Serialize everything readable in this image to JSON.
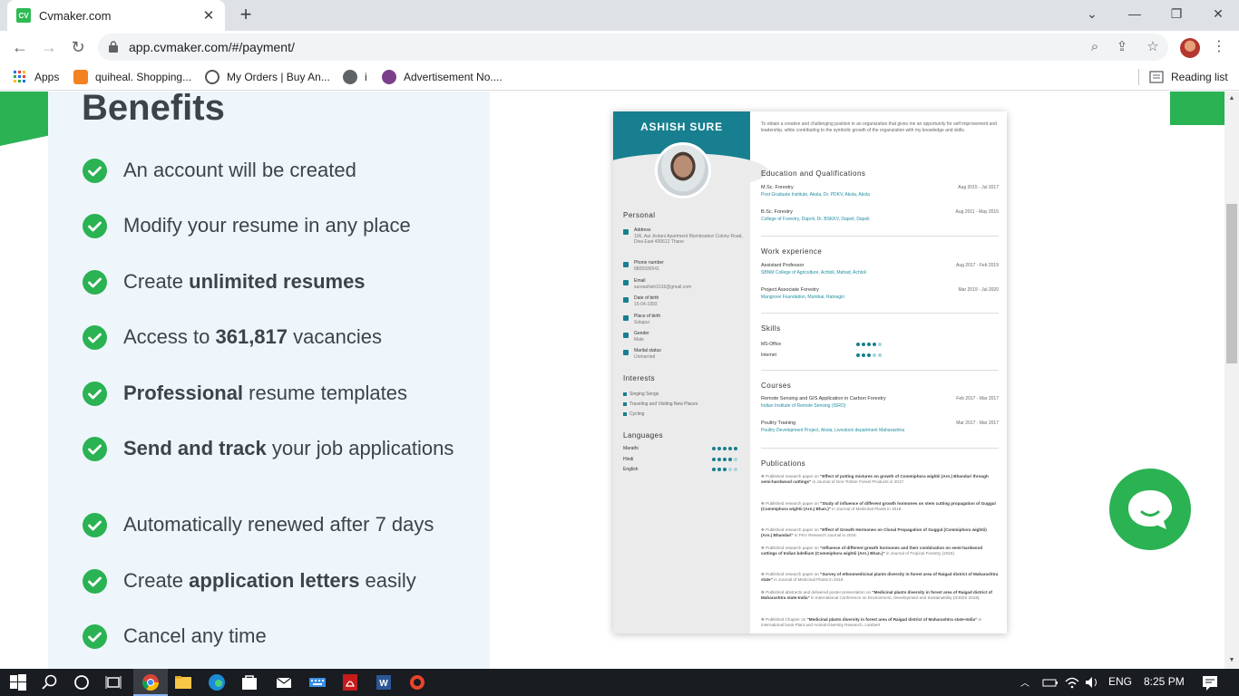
{
  "browser": {
    "tab_title": "Cvmaker.com",
    "favicon_text": "CV",
    "url": "app.cvmaker.com/#/payment/",
    "bookmarks": [
      {
        "label": "Apps",
        "icon": "apps-grid-icon"
      },
      {
        "label": "quiheal. Shopping...",
        "icon": "quiheal-icon"
      },
      {
        "label": "My Orders | Buy An...",
        "icon": "orders-icon"
      },
      {
        "label": "i",
        "icon": "globe-icon"
      },
      {
        "label": "Advertisement No....",
        "icon": "advert-icon"
      }
    ],
    "reading_list": "Reading list"
  },
  "benefits": {
    "title": "Benefits",
    "items": [
      {
        "pre": "An account will be created",
        "bold": "",
        "post": ""
      },
      {
        "pre": "Modify your resume in any place",
        "bold": "",
        "post": ""
      },
      {
        "pre": "Create ",
        "bold": "unlimited resumes",
        "post": ""
      },
      {
        "pre": "Access to ",
        "bold": "361,817",
        "post": " vacancies"
      },
      {
        "pre": "",
        "bold": "Professional",
        "post": " resume templates"
      },
      {
        "pre": "",
        "bold": "Send and track",
        "post": " your job applications"
      },
      {
        "pre": "Automatically renewed after 7 days",
        "bold": "",
        "post": ""
      },
      {
        "pre": "Create ",
        "bold": "application letters",
        "post": " easily"
      },
      {
        "pre": "Cancel any time",
        "bold": "",
        "post": ""
      }
    ]
  },
  "cv": {
    "name": "ASHISH SURE",
    "summary": "To obtain a creative and challenging position in an organization that gives me an opportunity for self improvement and leadership, while contributing to the symbolic growth of the organization with my knowledge and skills.",
    "personal_heading": "Personal",
    "personal": [
      {
        "label": "Address",
        "value": "106, Aai Jivdani Apartment Mumbradevi Colony Road, Diva East 400612 Thane"
      },
      {
        "label": "Phone number",
        "value": "8805930541"
      },
      {
        "label": "Email",
        "value": "sureashish1516@gmail.com"
      },
      {
        "label": "Date of birth",
        "value": "15-04-1993"
      },
      {
        "label": "Place of birth",
        "value": "Solapur"
      },
      {
        "label": "Gender",
        "value": "Male"
      },
      {
        "label": "Marital status",
        "value": "Unmarried"
      }
    ],
    "interests_heading": "Interests",
    "interests": [
      "Singing Songs",
      "Traveling and Visiting New Places",
      "Cycling"
    ],
    "languages_heading": "Languages",
    "languages": [
      {
        "name": "Marathi",
        "level": 5
      },
      {
        "name": "Hindi",
        "level": 4
      },
      {
        "name": "English",
        "level": 3
      }
    ],
    "education_heading": "Education and Qualifications",
    "education": [
      {
        "title": "M.Sc. Forestry",
        "sub": "Post Graduate Institute, Akola, Dr. PDKV, Akola, Akola",
        "date": "Aug 2015 - Jul 2017"
      },
      {
        "title": "B.Sc. Forestry",
        "sub": "College of Forestry, Dapoli, Dr. BSKKV, Dapoli, Dapoli",
        "date": "Aug 2011 - May 2015"
      }
    ],
    "work_heading": "Work experience",
    "work": [
      {
        "title": "Assistant Professor",
        "sub": "SBNM College of Agriculture, Achloli, Mahad, Achloli",
        "date": "Aug 2017 - Feb 2019"
      },
      {
        "title": "Project Associate Forestry",
        "sub": "Mangrove Foundation, Mumbai, Ratnagiri",
        "date": "Mar 2019 - Jul 2020"
      }
    ],
    "skills_heading": "Skills",
    "skills": [
      {
        "name": "MS-Office",
        "level": 4
      },
      {
        "name": "Internet",
        "level": 3
      }
    ],
    "courses_heading": "Courses",
    "courses": [
      {
        "title": "Remote Sensing and GIS Application in Carbon Forestry",
        "sub": "Indian Institute of Remote Sensing (ISRO)",
        "date": "Feb 2017 - Mar 2017"
      },
      {
        "title": "Poultry Training",
        "sub": "Poultry Development Project, Akola, Livestock department Maharashtra",
        "date": "Mar 2017 - Mar 2017"
      }
    ],
    "publications_heading": "Publications",
    "publications": [
      {
        "pre": "✥ Published research paper on ",
        "bold": "\"Effect of potting mixtures on growth of Commiphora wightii (Arn.) Bhandari through semi-hardwood cuttings\"",
        "post": " in Journal of Non-Timber Forest Products in 2017."
      },
      {
        "pre": "✥ Published research paper on ",
        "bold": "\"Study of influence of different growth hormones on stem cutting propagation of Guggul (Commiphora wightii (Arn.) Bhan.)\"",
        "post": " in Journal of Medicinal Plants in 2018."
      },
      {
        "pre": "✥ Published research paper on ",
        "bold": "\"Effect of Growth Hormones on Clonal Propagation of Guggul (Commiphora wightii) (Arn.) Bhandari\"",
        "post": " in PKV Research Journal in 2018."
      },
      {
        "pre": "✥ Published research paper on ",
        "bold": "\"Influence of different growth hormones and their combination on semi-hardwood cuttings of Indian bdellium (Commiphora wightii (Arn.) Bhan.)\"",
        "post": " in Journal of Tropical Forestry (2018)."
      },
      {
        "pre": "✥ Published research paper on ",
        "bold": "\"Survey of ethnomedicinal plants diversity in forest area of Raigad district of Maharashtra state\"",
        "post": " in Journal of Medicinal Plants in 2019."
      },
      {
        "pre": "✥ Published abstracts and delivered poster presentation on ",
        "bold": "\"Medicinal plants diversity in forest area of Raigad district of Maharashtra state-India\"",
        "post": " in International Conference on Environment, Development and Sustainability (ICEDS 2018)."
      },
      {
        "pre": "✥ Published Chapter on ",
        "bold": "\"Medicinal plants diversity in forest area of Raigad district of Maharashtra state-India\"",
        "post": " in international book Plant and Animal Diversity Research, Lambert"
      }
    ]
  },
  "taskbar": {
    "language": "ENG",
    "time": "8:25 PM"
  },
  "colors": {
    "brand_green": "#2ab253",
    "cv_teal": "#177f8f",
    "panel_bg": "#eef6fc"
  }
}
